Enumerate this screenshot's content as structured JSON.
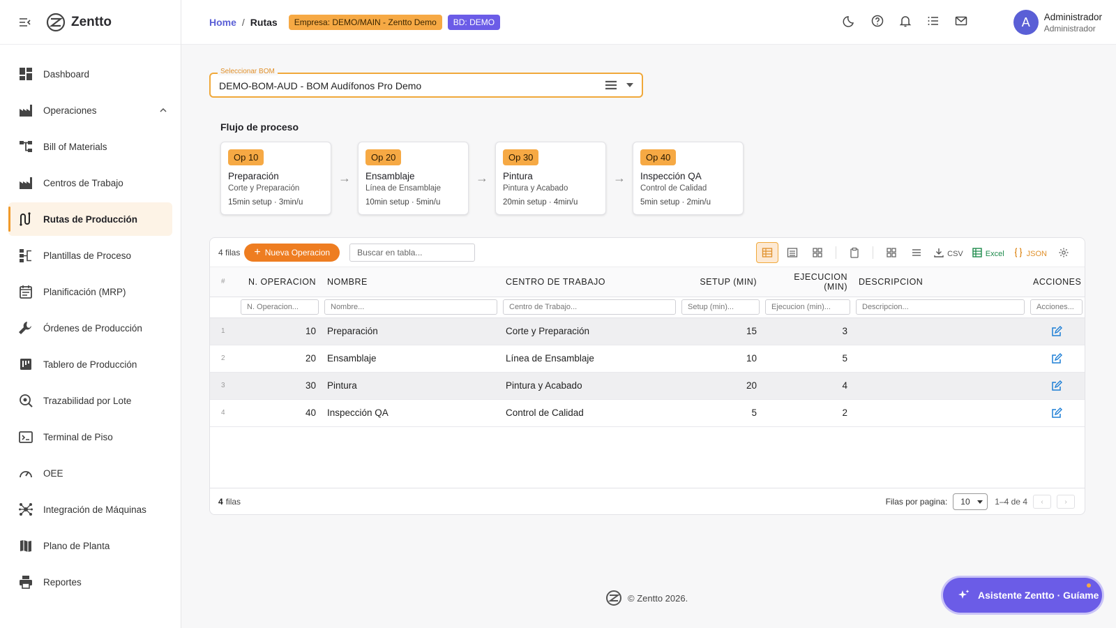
{
  "app": {
    "name": "Zentto"
  },
  "sidebar": {
    "items": [
      {
        "label": "Dashboard",
        "icon": "dashboard-icon"
      },
      {
        "label": "Operaciones",
        "icon": "factory-icon",
        "expanded": true
      },
      {
        "label": "Bill of Materials",
        "icon": "tree-icon"
      },
      {
        "label": "Centros de Trabajo",
        "icon": "factory-icon"
      },
      {
        "label": "Rutas de Producción",
        "icon": "route-icon",
        "active": true
      },
      {
        "label": "Plantillas de Proceso",
        "icon": "template-icon"
      },
      {
        "label": "Planificación (MRP)",
        "icon": "calendar-icon"
      },
      {
        "label": "Órdenes de Producción",
        "icon": "wrench-icon"
      },
      {
        "label": "Tablero de Producción",
        "icon": "board-icon"
      },
      {
        "label": "Trazabilidad por Lote",
        "icon": "trace-icon"
      },
      {
        "label": "Terminal de Piso",
        "icon": "terminal-icon"
      },
      {
        "label": "OEE",
        "icon": "gauge-icon"
      },
      {
        "label": "Integración de Máquinas",
        "icon": "hub-icon"
      },
      {
        "label": "Plano de Planta",
        "icon": "map-icon"
      },
      {
        "label": "Reportes",
        "icon": "printer-icon"
      }
    ]
  },
  "header": {
    "breadcrumb_home": "Home",
    "breadcrumb_sep": "/",
    "breadcrumb_current": "Rutas",
    "empresa_badge": "Empresa: DEMO/MAIN - Zentto Demo",
    "bd_badge": "BD: DEMO",
    "user_initial": "A",
    "user_name": "Administrador",
    "user_role": "Administrador"
  },
  "bom": {
    "label": "Seleccionar BOM",
    "value": "DEMO-BOM-AUD - BOM Audífonos Pro Demo"
  },
  "flow": {
    "title": "Flujo de proceso",
    "arrow": "→",
    "ops": [
      {
        "badge": "Op 10",
        "name": "Preparación",
        "center": "Corte y Preparación",
        "times": "15min setup · 3min/u"
      },
      {
        "badge": "Op 20",
        "name": "Ensamblaje",
        "center": "Línea de Ensamblaje",
        "times": "10min setup · 5min/u"
      },
      {
        "badge": "Op 30",
        "name": "Pintura",
        "center": "Pintura y Acabado",
        "times": "20min setup · 4min/u"
      },
      {
        "badge": "Op 40",
        "name": "Inspección QA",
        "center": "Control de Calidad",
        "times": "5min setup · 2min/u"
      }
    ]
  },
  "table": {
    "rows_label": "4 filas",
    "new_button": "Nueva Operacion",
    "search_placeholder": "Buscar en tabla...",
    "tools": {
      "csv": "CSV",
      "excel": "Excel",
      "json": "JSON"
    },
    "columns": {
      "idx": "#",
      "op_no": "N. OPERACION",
      "name": "NOMBRE",
      "center": "CENTRO DE TRABAJO",
      "setup": "SETUP (MIN)",
      "exec": "EJECUCION (MIN)",
      "desc": "DESCRIPCION",
      "actions": "ACCIONES"
    },
    "filters": {
      "op_no": "N. Operacion...",
      "name": "Nombre...",
      "center": "Centro de Trabajo...",
      "setup": "Setup (min)...",
      "exec": "Ejecucion (min)...",
      "desc": "Descripcion...",
      "actions": "Acciones..."
    },
    "rows": [
      {
        "idx": "1",
        "op_no": "10",
        "name": "Preparación",
        "center": "Corte y Preparación",
        "setup": "15",
        "exec": "3",
        "desc": ""
      },
      {
        "idx": "2",
        "op_no": "20",
        "name": "Ensamblaje",
        "center": "Línea de Ensamblaje",
        "setup": "10",
        "exec": "5",
        "desc": ""
      },
      {
        "idx": "3",
        "op_no": "30",
        "name": "Pintura",
        "center": "Pintura y Acabado",
        "setup": "20",
        "exec": "4",
        "desc": ""
      },
      {
        "idx": "4",
        "op_no": "40",
        "name": "Inspección QA",
        "center": "Control de Calidad",
        "setup": "5",
        "exec": "2",
        "desc": ""
      }
    ],
    "footer_count": "4",
    "footer_label": "filas",
    "rows_per_page_label": "Filas por pagina:",
    "rows_per_page": "10",
    "range": "1–4 de 4",
    "prev": "‹",
    "next": "›"
  },
  "footer": {
    "copyright": "© Zentto 2026."
  },
  "assistant": {
    "label": "Asistente Zentto · Guíame"
  },
  "colors": {
    "accent": "#ee7d21",
    "primary": "#6b5ce7",
    "active_bg": "#fdf3e6"
  }
}
